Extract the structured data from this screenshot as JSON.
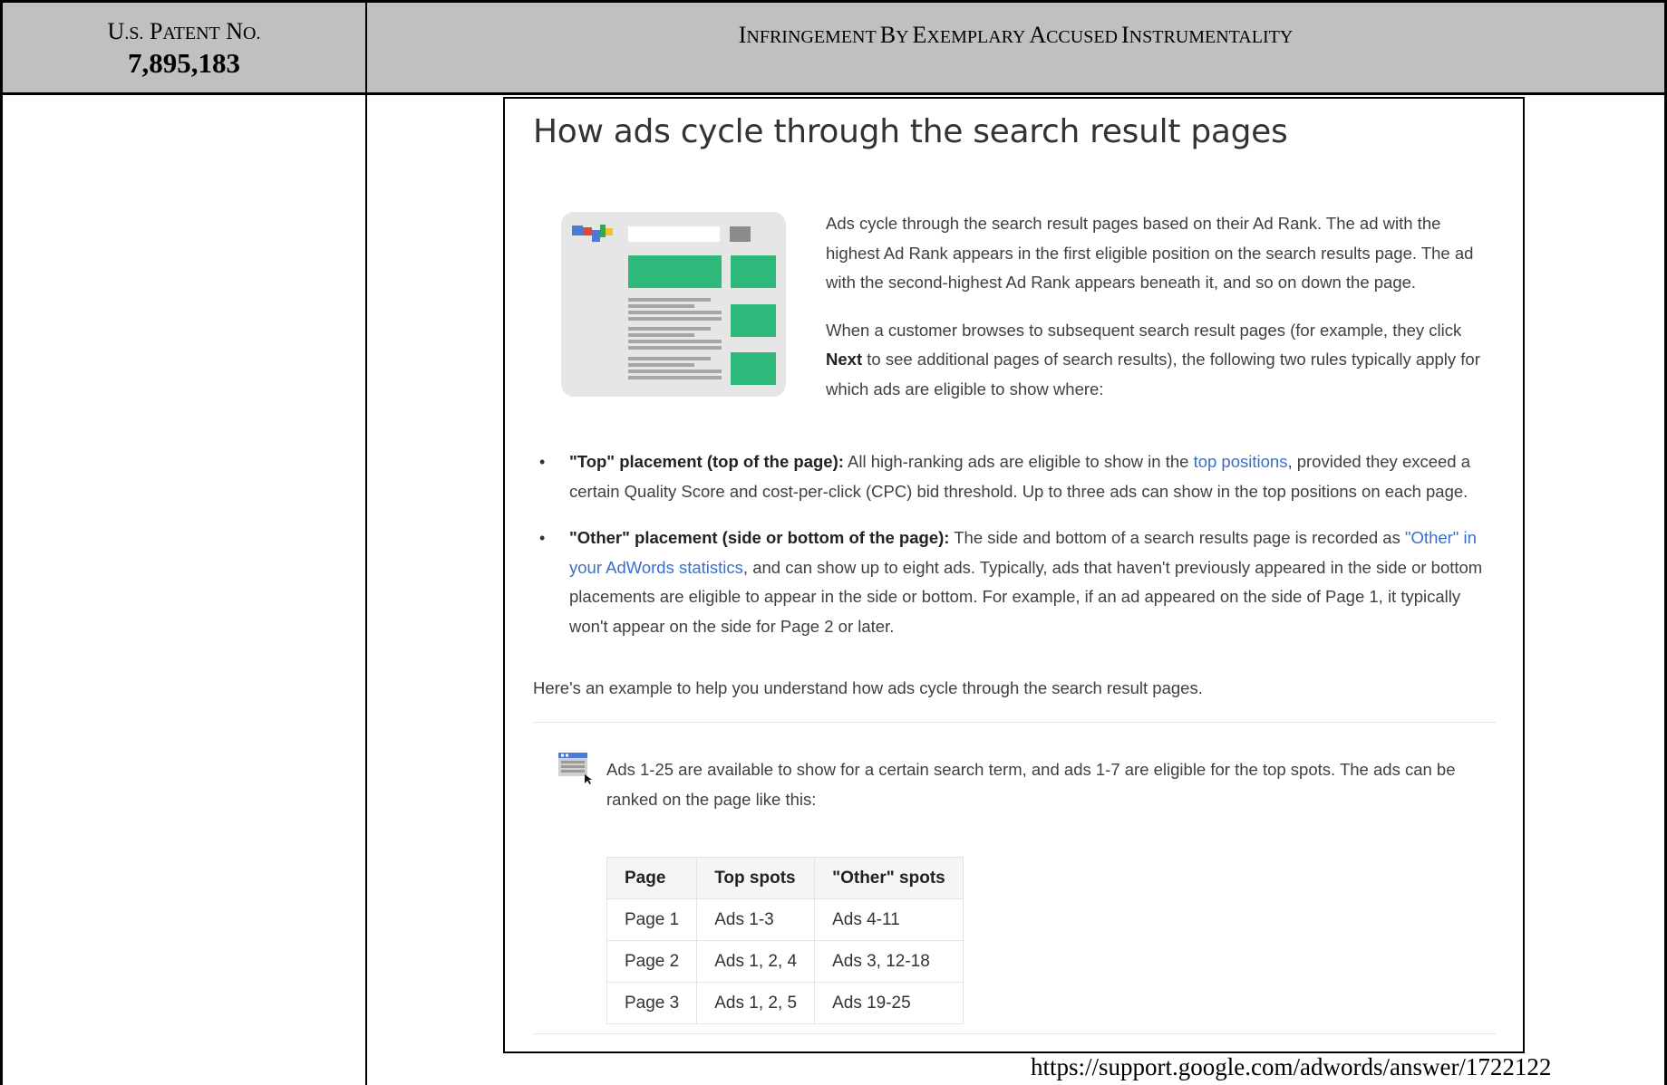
{
  "header": {
    "col1_line1": "U.S. Patent No.",
    "col1_line2": "7,895,183",
    "col2": "Infringement by Exemplary Accused Instrumentality"
  },
  "colors": {
    "header_bg": "#c0c0c0",
    "link": "#3b6fc4",
    "ad_green": "#2eb87a"
  },
  "screenshot": {
    "title": "How ads cycle through the search result pages",
    "intro_p1": "Ads cycle through the search result pages based on their Ad Rank. The ad with the highest Ad Rank appears in the first eligible position on the search results page. The ad with the second-highest Ad Rank appears beneath it, and so on down the page.",
    "intro_p2_pre": "When a customer browses to subsequent search result pages (for example, they click ",
    "intro_p2_bold": "Next",
    "intro_p2_post": " to see additional pages of search results), the following two rules typically apply for which ads are eligible to show where:",
    "bullets": [
      {
        "bold": "\"Top\" placement (top of the page):",
        "pre": " All high-ranking ads are eligible to show in the ",
        "link": "top positions",
        "post": ", provided they exceed a certain Quality Score and cost-per-click (CPC) bid threshold. Up to three ads can show in the top positions on each page."
      },
      {
        "bold": "\"Other\" placement (side or bottom of the page):",
        "pre": " The side and bottom of a search results page is recorded as ",
        "link": "\"Other\" in your AdWords statistics",
        "post": ", and can show up to eight ads. Typically, ads that haven't previously appeared in the side or bottom placements are eligible to appear in the side or bottom. For example, if an ad appeared on the side of Page 1, it typically won't appear on the side for Page 2 or later."
      }
    ],
    "example_text": "Here's an example to help you understand how ads cycle through the search result pages.",
    "callout_text": "Ads 1-25 are available to show for a certain search term, and ads 1-7 are eligible for the top spots. The ads can be ranked on the page like this:",
    "table": {
      "headers": [
        "Page",
        "Top spots",
        "\"Other\" spots"
      ],
      "rows": [
        [
          "Page 1",
          "Ads 1-3",
          "Ads 4-11"
        ],
        [
          "Page 2",
          "Ads 1, 2, 4",
          "Ads 3, 12-18"
        ],
        [
          "Page 3",
          "Ads 1, 2, 5",
          "Ads 19-25"
        ]
      ]
    }
  },
  "source_url": "https://support.google.com/adwords/answer/1722122"
}
